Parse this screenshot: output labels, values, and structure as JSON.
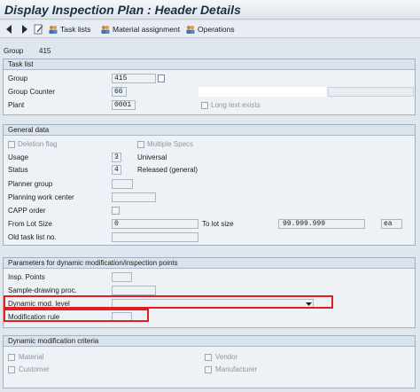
{
  "window": {
    "title": "Display Inspection Plan : Header Details"
  },
  "toolbar": {
    "task_lists": "Task lists",
    "material_assignment": "Material assignment",
    "operations": "Operations"
  },
  "header": {
    "group_label": "Group",
    "group_value": "415"
  },
  "task_list": {
    "title": "Task list",
    "group_label": "Group",
    "group_value": "415",
    "group_counter_label": "Group Counter",
    "group_counter_value": "66",
    "plant_label": "Plant",
    "plant_value": "0001",
    "long_text_label": "Long text exists"
  },
  "general": {
    "title": "General data",
    "deletion_flag": "Deletion flag",
    "multiple_specs": "Multiple Specs",
    "usage_label": "Usage",
    "usage_value": "3",
    "usage_text": "Universal",
    "status_label": "Status",
    "status_value": "4",
    "status_text": "Released (general)",
    "planner_group_label": "Planner group",
    "planning_wc_label": "Planning work center",
    "capp_label": "CAPP order",
    "from_lot_label": "From Lot Size",
    "from_lot_value": "0",
    "to_lot_label": "To lot size",
    "to_lot_value": "99.999.999",
    "unit_value": "ea",
    "old_task_label": "Old task list no."
  },
  "dynamic_params": {
    "title": "Parameters for dynamic modification/inspection points",
    "insp_points_label": "Insp. Points",
    "sample_drawing_label": "Sample-drawing proc.",
    "dyn_mod_level_label": "Dynamic mod. level",
    "modification_rule_label": "Modification rule"
  },
  "dynamic_criteria": {
    "title": "Dynamic modification criteria",
    "material": "Material",
    "vendor": "Vendor",
    "customer": "Customer",
    "manufacturer": "Manufacturer"
  }
}
